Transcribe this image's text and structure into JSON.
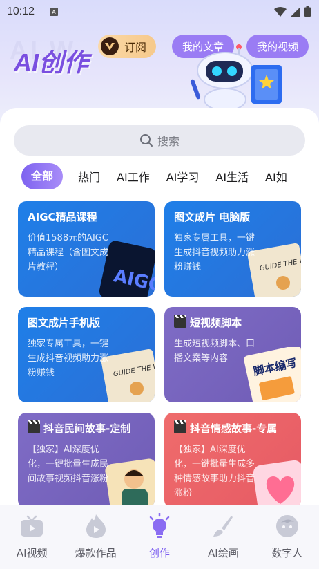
{
  "status_bar": {
    "time": "10:12",
    "notification_glyph": "A"
  },
  "hero": {
    "title": "AI创作",
    "watermark": "AI W",
    "subscribe_label": "订阅",
    "my_articles_label": "我的文章",
    "my_videos_label": "我的视频"
  },
  "search": {
    "placeholder": "搜索"
  },
  "tabs": [
    {
      "label": "全部",
      "active": true
    },
    {
      "label": "热门"
    },
    {
      "label": "AI工作"
    },
    {
      "label": "AI学习"
    },
    {
      "label": "AI生活"
    },
    {
      "label": "AI如"
    }
  ],
  "cards": [
    {
      "title": "AIGC精品课程",
      "desc": "价值1588元的AIGC精品课程（含图文成片教程）",
      "art_text": "AIGC"
    },
    {
      "title": "图文成片 电脑版",
      "desc": "独家专属工具，一键生成抖音视频助力涨粉赚钱",
      "art_text": "GUIDE THE WORLD"
    },
    {
      "title": "图文成片手机版",
      "desc": "独家专属工具，一键生成抖音视频助力涨粉赚钱",
      "art_text": "GUIDE THE WORLD"
    },
    {
      "title": "短视频脚本",
      "desc": "生成短视频脚本、口播文案等内容",
      "art_text": "脚本编写"
    },
    {
      "title": "抖音民间故事-定制",
      "desc": "【独家】AI深度优化，一键批量生成民间故事视频抖音涨粉"
    },
    {
      "title": "抖音情感故事-专属",
      "desc": "【独家】AI深度优化，一键批量生成多种情感故事助力抖音涨粉"
    }
  ],
  "bottom_nav": [
    {
      "label": "AI视频"
    },
    {
      "label": "爆款作品"
    },
    {
      "label": "创作",
      "active": true
    },
    {
      "label": "AI绘画"
    },
    {
      "label": "数字人"
    }
  ],
  "colors": {
    "accent": "#7a5cf0",
    "card_blue": "#2178e6",
    "card_purple": "#7866c0",
    "card_red": "#ec6468"
  }
}
